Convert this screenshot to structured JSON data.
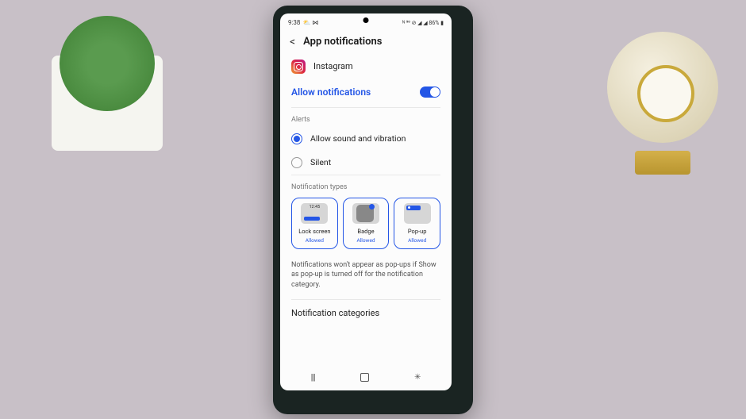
{
  "status": {
    "time": "9:38",
    "icons_left": "⛅ ⋈",
    "icons_right": "ᴺ ⁵⁰ ⊘ ◢ ◢ 86% ▮"
  },
  "header": {
    "title": "App notifications"
  },
  "app": {
    "name": "Instagram"
  },
  "allow": {
    "label": "Allow notifications",
    "on": true
  },
  "sections": {
    "alerts_label": "Alerts",
    "types_label": "Notification types"
  },
  "alerts": {
    "sound_label": "Allow sound and vibration",
    "silent_label": "Silent",
    "selected": "sound"
  },
  "types": [
    {
      "title": "Lock screen",
      "status": "Allowed",
      "preview_time": "12:45"
    },
    {
      "title": "Badge",
      "status": "Allowed"
    },
    {
      "title": "Pop-up",
      "status": "Allowed"
    }
  ],
  "help_text": "Notifications won't appear as pop-ups if Show as pop-up is turned off for the notification category.",
  "categories": {
    "label": "Notification categories"
  }
}
